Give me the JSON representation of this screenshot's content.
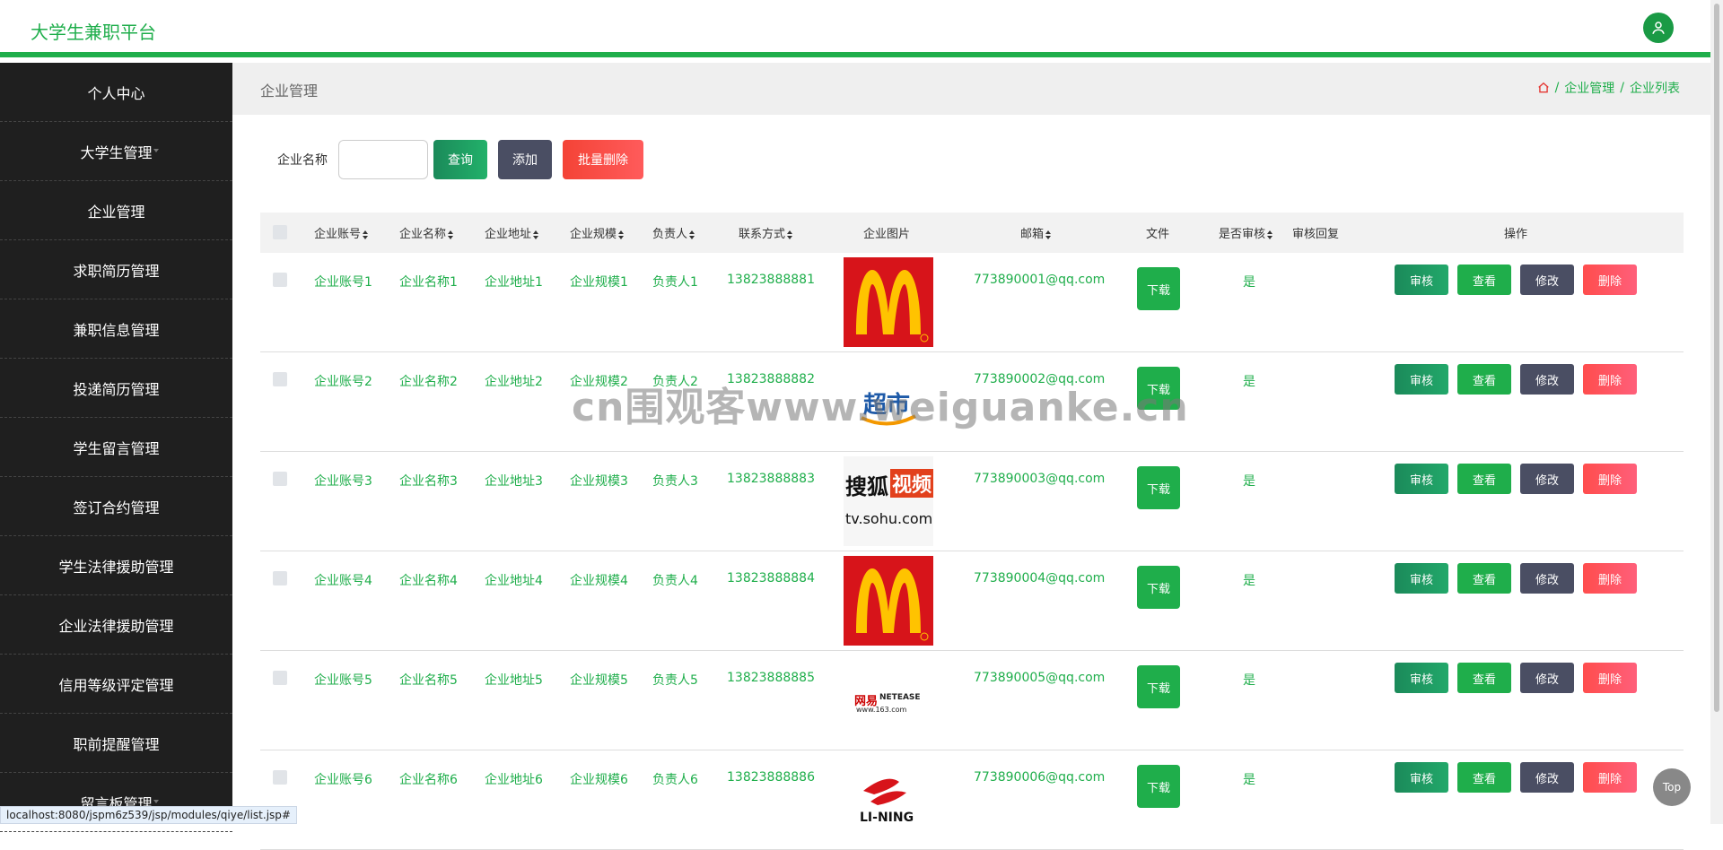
{
  "brand": {
    "title": "大学生兼职平台"
  },
  "sidebar": {
    "items": [
      {
        "label": "个人中心"
      },
      {
        "label": "大学生管理"
      },
      {
        "label": "企业管理"
      },
      {
        "label": "求职简历管理"
      },
      {
        "label": "兼职信息管理"
      },
      {
        "label": "投递简历管理"
      },
      {
        "label": "学生留言管理"
      },
      {
        "label": "签订合约管理"
      },
      {
        "label": "学生法律援助管理"
      },
      {
        "label": "企业法律援助管理"
      },
      {
        "label": "信用等级评定管理"
      },
      {
        "label": "职前提醒管理"
      },
      {
        "label": "留言板管理"
      }
    ]
  },
  "breadcrumb": {
    "title": "企业管理",
    "level1": "企业管理",
    "level2": "企业列表",
    "sep": "/"
  },
  "search": {
    "label": "企业名称",
    "value": "",
    "query": "查询",
    "add": "添加",
    "batch_delete": "批量删除"
  },
  "table": {
    "headers": {
      "account": "企业账号",
      "name": "企业名称",
      "address": "企业地址",
      "scale": "企业规模",
      "manager": "负责人",
      "contact": "联系方式",
      "image": "企业图片",
      "email": "邮箱",
      "file": "文件",
      "audited": "是否审核",
      "reply": "审核回复",
      "ops": "操作"
    },
    "rows": [
      {
        "account": "企业账号1",
        "name": "企业名称1",
        "address": "企业地址1",
        "scale": "企业规模1",
        "manager": "负责人1",
        "contact": "13823888881",
        "email": "773890001@qq.com",
        "audited": "是",
        "logo": "mcdonalds"
      },
      {
        "account": "企业账号2",
        "name": "企业名称2",
        "address": "企业地址2",
        "scale": "企业规模2",
        "manager": "负责人2",
        "contact": "13823888882",
        "email": "773890002@qq.com",
        "audited": "是",
        "logo": "chaoshi"
      },
      {
        "account": "企业账号3",
        "name": "企业名称3",
        "address": "企业地址3",
        "scale": "企业规模3",
        "manager": "负责人3",
        "contact": "13823888883",
        "email": "773890003@qq.com",
        "audited": "是",
        "logo": "sohu"
      },
      {
        "account": "企业账号4",
        "name": "企业名称4",
        "address": "企业地址4",
        "scale": "企业规模4",
        "manager": "负责人4",
        "contact": "13823888884",
        "email": "773890004@qq.com",
        "audited": "是",
        "logo": "mcdonalds"
      },
      {
        "account": "企业账号5",
        "name": "企业名称5",
        "address": "企业地址5",
        "scale": "企业规模5",
        "manager": "负责人5",
        "contact": "13823888885",
        "email": "773890005@qq.com",
        "audited": "是",
        "logo": "netease"
      },
      {
        "account": "企业账号6",
        "name": "企业名称6",
        "address": "企业地址6",
        "scale": "企业规模6",
        "manager": "负责人6",
        "contact": "13823888886",
        "email": "773890006@qq.com",
        "audited": "是",
        "logo": "lining"
      }
    ],
    "buttons": {
      "download": "下载",
      "audit": "审核",
      "view": "查看",
      "edit": "修改",
      "delete": "删除"
    }
  },
  "logos": {
    "sohu_cn": "搜狐",
    "sohu_video": "视频",
    "sohu_url": "tv.sohu.com",
    "netease_cn": "网易",
    "netease_en": "NETEASE",
    "netease_url": "www.163.com",
    "lining": "LI-NING"
  },
  "status_url": "localhost:8080/jspm6z539/jsp/modules/qiye/list.jsp#",
  "top_button": "Top",
  "watermark": "cn围观客www.weiguanke.cn",
  "colors": {
    "primary": "#1fae4b",
    "sidebar": "#1f1f1f",
    "danger": "#ff4d4d",
    "dark": "#4a4e63"
  }
}
